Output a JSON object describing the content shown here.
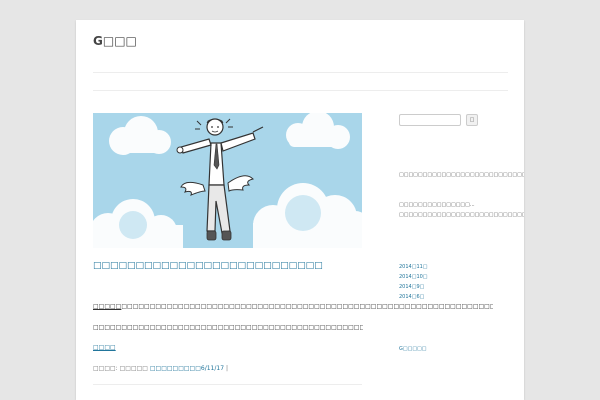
{
  "site": {
    "title": "G□□□"
  },
  "post": {
    "title": "□□□□□□□□□□□□□□□□□□□□□□□□□□□",
    "paragraph1_lead": "□□□□□",
    "paragraph1_rest": "□□□□□□□□□□□□□□□□□□□□□□□□□□□□□□□□□□□□□□□□□□□□□□□□□□□□□□□□□□□□□□□□□□□□□□□□□□□□□□",
    "paragraph2": "□□□□□□□□□□□□□□□□□□□□□□□□□□□□□□□□□□□□□□□□□□□□□□□□□□□□□□□",
    "more_link": "□□□□",
    "meta_prefix": "□□□□: □□□□□",
    "meta_date": "□□□□□□□□□6/11/17",
    "meta_suffix": " |"
  },
  "sidebar": {
    "search_value": "",
    "search_button": "□",
    "text1": "□□□□□□□□□□□□□□□□□□□□□□□□□□□□□□□□□□□□□□□□□□□□□□□□□□",
    "text2": "□□□□□□□□□□□□□□□... □□□□□□□□□□□□□□□□□□□□□□□□□□□□□□□□□□□□□□□G□□□□□",
    "archives": [
      "2014□11□",
      "2014□10□",
      "2014□9□",
      "2014□6□"
    ],
    "bottom_link": "G□□□□□"
  },
  "colors": {
    "link": "#21759b",
    "hero_sky": "#a9d6ea",
    "background": "#e6e6e6"
  }
}
